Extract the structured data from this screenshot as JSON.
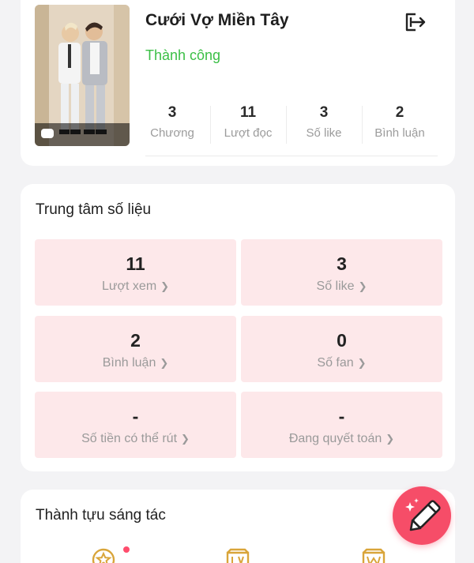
{
  "book": {
    "title": "Cưới Vợ Miền Tây",
    "status": "Thành công",
    "stats": [
      {
        "value": "3",
        "label": "Chương"
      },
      {
        "value": "11",
        "label": "Lượt đọc"
      },
      {
        "value": "3",
        "label": "Số like"
      },
      {
        "value": "2",
        "label": "Bình luận"
      }
    ]
  },
  "data_center": {
    "title": "Trung tâm số liệu",
    "tiles": [
      {
        "value": "11",
        "label": "Lượt xem"
      },
      {
        "value": "3",
        "label": "Số like"
      },
      {
        "value": "2",
        "label": "Bình luận"
      },
      {
        "value": "0",
        "label": "Số fan"
      },
      {
        "value": "-",
        "label": "Số tiền có thể rút"
      },
      {
        "value": "-",
        "label": "Đang quyết toán"
      }
    ]
  },
  "achievements": {
    "title": "Thành tựu sáng tác",
    "icons": [
      "star-medal-icon",
      "lv-badge-icon",
      "w-badge-icon"
    ]
  },
  "icons": {
    "exit": "exit-icon",
    "fab": "pen-sparkle-icon",
    "chevron": "chevron-right-icon"
  },
  "colors": {
    "status_green": "#3bbf46",
    "tile_bg": "#fde8ea",
    "fab_bg": "#f64d68",
    "achievement_gold": "#d9a53a"
  }
}
